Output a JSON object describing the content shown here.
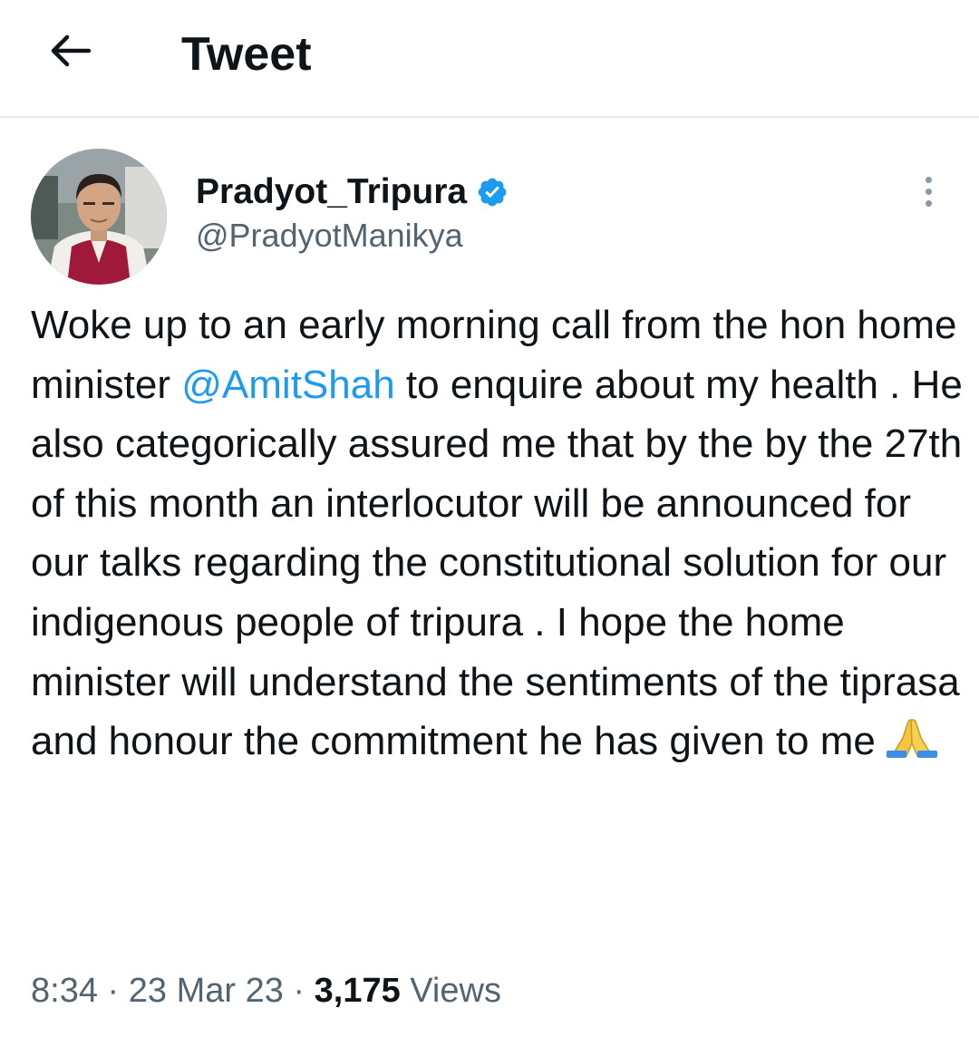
{
  "header": {
    "title": "Tweet",
    "back_icon": "arrow-left-icon"
  },
  "author": {
    "display_name": "Pradyot_Tripura",
    "handle": "@PradyotManikya",
    "verified_icon": "verified-badge-icon",
    "verified_color": "#1d9bf0"
  },
  "tweet": {
    "text_before_mention": "Woke up to an early morning call from the hon home minister ",
    "mention": "@AmitShah",
    "text_after_mention": " to enquire about my health . He also categorically assured me that by the by the 27th of this month an interlocutor will be announced for our talks regarding the constitutional solution for our indigenous people of tripura . I hope the home minister will understand the sentiments of the tiprasa and honour the commitment he has given to me",
    "emoji": "folded-hands-emoji",
    "mention_color": "#1d9bf0"
  },
  "meta": {
    "time": "8:34",
    "separator": " · ",
    "date": "23 Mar 23",
    "views_count": "3,175",
    "views_label": " Views"
  },
  "colors": {
    "text": "#0f1419",
    "secondary": "#536471",
    "divider": "#e6e8ea"
  }
}
